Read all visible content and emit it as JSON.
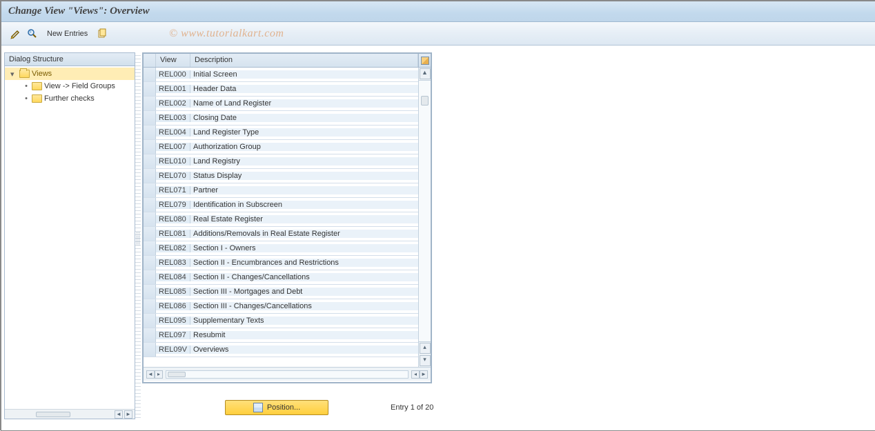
{
  "title": "Change View \"Views\": Overview",
  "watermark": "© www.tutorialkart.com",
  "toolbar": {
    "new_entries": "New Entries"
  },
  "dialog": {
    "header": "Dialog Structure",
    "root": "Views",
    "children": [
      "View -> Field Groups",
      "Further checks"
    ]
  },
  "table": {
    "headers": {
      "view": "View",
      "description": "Description"
    },
    "rows": [
      {
        "view": "REL000",
        "desc": "Initial Screen"
      },
      {
        "view": "REL001",
        "desc": "Header Data"
      },
      {
        "view": "REL002",
        "desc": "Name of Land Register"
      },
      {
        "view": "REL003",
        "desc": "Closing Date"
      },
      {
        "view": "REL004",
        "desc": "Land Register Type"
      },
      {
        "view": "REL007",
        "desc": "Authorization Group"
      },
      {
        "view": "REL010",
        "desc": "Land Registry"
      },
      {
        "view": "REL070",
        "desc": "Status Display"
      },
      {
        "view": "REL071",
        "desc": "Partner"
      },
      {
        "view": "REL079",
        "desc": "Identification in Subscreen"
      },
      {
        "view": "REL080",
        "desc": "Real Estate Register"
      },
      {
        "view": "REL081",
        "desc": "Additions/Removals in Real Estate Register"
      },
      {
        "view": "REL082",
        "desc": "Section I - Owners"
      },
      {
        "view": "REL083",
        "desc": "Section II - Encumbrances and Restrictions"
      },
      {
        "view": "REL084",
        "desc": "Section II - Changes/Cancellations"
      },
      {
        "view": "REL085",
        "desc": "Section III - Mortgages and Debt"
      },
      {
        "view": "REL086",
        "desc": "Section III - Changes/Cancellations"
      },
      {
        "view": "REL095",
        "desc": "Supplementary Texts"
      },
      {
        "view": "REL097",
        "desc": "Resubmit"
      },
      {
        "view": "REL09V",
        "desc": "Overviews"
      }
    ]
  },
  "footer": {
    "position": "Position...",
    "entry_text": "Entry 1 of 20"
  }
}
